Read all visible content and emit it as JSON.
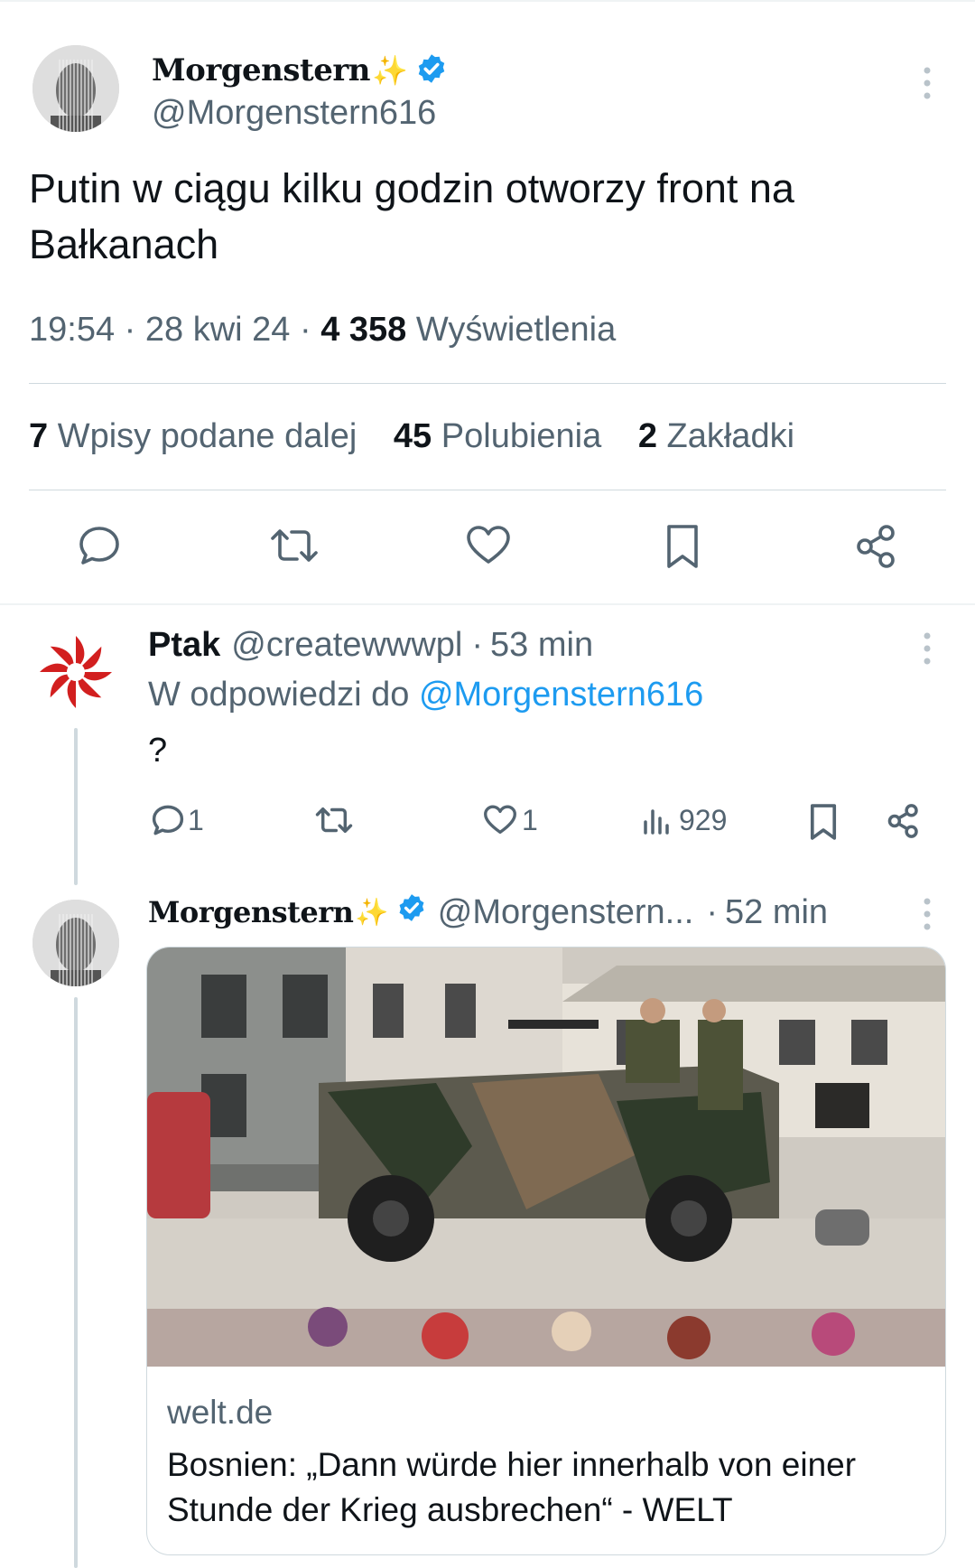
{
  "main_tweet": {
    "display_name": "Morgenstern",
    "name_emoji": "✨",
    "handle": "@Morgenstern616",
    "text": "Putin w ciągu kilku godzin otworzy front na Bałkanach",
    "time": "19:54",
    "date": "28 kwi 24",
    "views_count": "4 358",
    "views_label": "Wyświetlenia",
    "stats": {
      "reposts_count": "7",
      "reposts_label": "Wpisy podane dalej",
      "likes_count": "45",
      "likes_label": "Polubienia",
      "bookmarks_count": "2",
      "bookmarks_label": "Zakładki"
    }
  },
  "reply": {
    "display_name": "Ptak",
    "handle": "@createwwwpl",
    "time": "53 min",
    "replying_prefix": "W odpowiedzi do",
    "replying_to": "@Morgenstern616",
    "text": "?",
    "reply_count": "1",
    "like_count": "1",
    "view_count": "929"
  },
  "sub_reply": {
    "display_name": "Morgenstern",
    "name_emoji": "✨",
    "handle": "@Morgenstern...",
    "time": "52 min",
    "card": {
      "domain": "welt.de",
      "title": "Bosnien: „Dann würde hier innerhalb von einer Stunde der Krieg ausbrechen“ - WELT"
    }
  },
  "separator": "·",
  "colors": {
    "accent": "#1d9bf0",
    "secondary_text": "#536471",
    "divider": "#cfd9de"
  }
}
